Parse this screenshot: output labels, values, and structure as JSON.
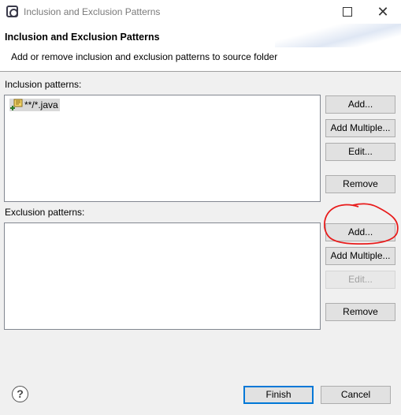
{
  "window": {
    "title": "Inclusion and Exclusion Patterns"
  },
  "header": {
    "title": "Inclusion and Exclusion Patterns",
    "description": "Add or remove inclusion and exclusion patterns to source folder"
  },
  "inclusion": {
    "label": "Inclusion patterns:",
    "items": [
      {
        "icon": "inclusion-pattern-icon",
        "text": "**/*.java"
      }
    ],
    "buttons": {
      "add": "Add...",
      "add_multiple": "Add Multiple...",
      "edit": "Edit...",
      "remove": "Remove"
    }
  },
  "exclusion": {
    "label": "Exclusion patterns:",
    "items": [],
    "buttons": {
      "add": "Add...",
      "add_multiple": "Add Multiple...",
      "edit": "Edit...",
      "remove": "Remove"
    },
    "edit_enabled": false
  },
  "footer": {
    "finish": "Finish",
    "cancel": "Cancel",
    "help_icon": "help-icon"
  },
  "colors": {
    "annotation": "#e81b1b",
    "default_button_border": "#0078d7"
  }
}
